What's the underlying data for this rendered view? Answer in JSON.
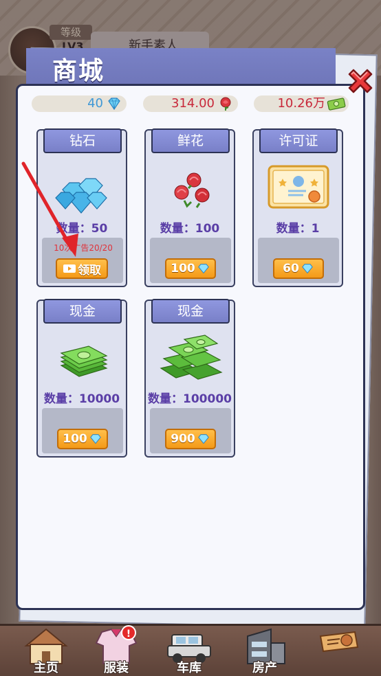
{
  "hud": {
    "level_tag": "等级",
    "level": "LV3",
    "rank_title": "新手素人"
  },
  "shop": {
    "title": "商城",
    "currencies": [
      {
        "value": "40",
        "icon": "diamond-icon",
        "color": "#3f98d6"
      },
      {
        "value": "314.00",
        "icon": "rose-icon",
        "color": "#c8283a"
      },
      {
        "value": "10.26万",
        "icon": "cash-icon",
        "color": "#c8283a"
      }
    ],
    "items": [
      {
        "name": "钻石",
        "quantity": "数量：50",
        "note": "10次广告20/20",
        "button": "领取",
        "button_icon": "video-icon",
        "image": "diamonds-icon"
      },
      {
        "name": "鲜花",
        "quantity": "数量：100",
        "price": "100",
        "price_icon": "diamond-icon",
        "image": "roses-icon"
      },
      {
        "name": "许可证",
        "quantity": "数量：1",
        "price": "60",
        "price_icon": "diamond-icon",
        "image": "certificate-icon"
      },
      {
        "name": "现金",
        "quantity": "数量：10000",
        "price": "100",
        "price_icon": "diamond-icon",
        "image": "cash-stack-icon"
      },
      {
        "name": "现金",
        "quantity": "数量：100000",
        "price": "900",
        "price_icon": "diamond-icon",
        "image": "cash-pile-icon"
      }
    ]
  },
  "nav": [
    {
      "label": "主页",
      "icon": "house-icon"
    },
    {
      "label": "服装",
      "icon": "outfit-icon",
      "badge": "!"
    },
    {
      "label": "车库",
      "icon": "car-icon"
    },
    {
      "label": "房产",
      "icon": "building-icon"
    },
    {
      "label": "",
      "icon": "event-icon"
    }
  ]
}
